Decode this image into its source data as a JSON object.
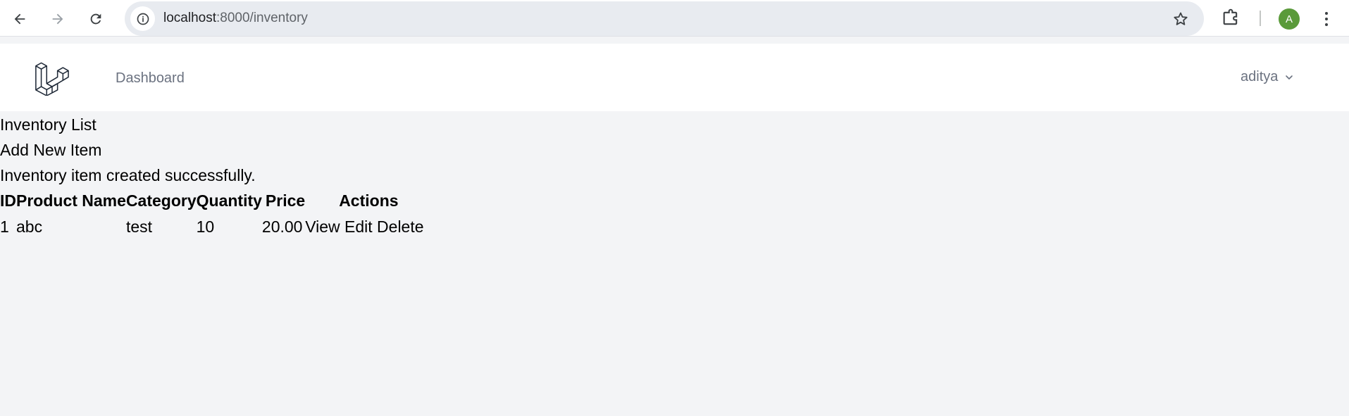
{
  "browser": {
    "url_host": "localhost",
    "url_path": ":8000/inventory",
    "profile_initial": "A",
    "icons": {
      "back": "arrow-left-icon",
      "forward": "arrow-right-icon",
      "reload": "reload-icon",
      "site_info": "info-icon",
      "bookmark": "star-icon",
      "extensions": "puzzle-icon",
      "menu": "kebab-menu-icon"
    }
  },
  "nav": {
    "logo": "laravel-logo",
    "dashboard_label": "Dashboard",
    "user_name": "aditya"
  },
  "page": {
    "title": "Inventory List",
    "add_link": "Add New Item",
    "flash_message": "Inventory item created successfully."
  },
  "table": {
    "headers": [
      "ID",
      "Product Name",
      "Category",
      "Quantity",
      "Price",
      "Actions"
    ],
    "rows": [
      {
        "id": "1",
        "name": "abc",
        "category": "test",
        "quantity": "10",
        "price": "20.00",
        "actions": [
          "View",
          "Edit",
          "Delete"
        ]
      }
    ]
  },
  "colors": {
    "page_bg": "#f3f4f6",
    "avatar_bg": "#5a9a3a",
    "nav_text": "#6b7280"
  }
}
